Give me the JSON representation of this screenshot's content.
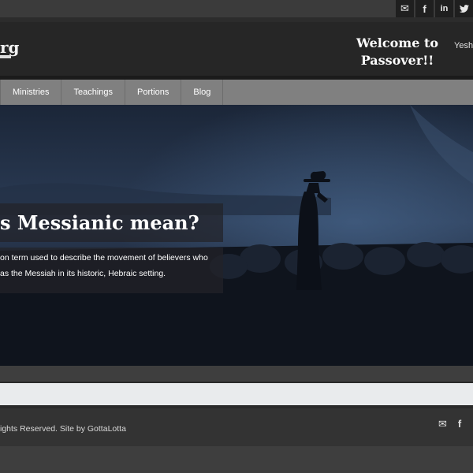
{
  "social_top": {
    "email_glyph": "✉",
    "facebook_glyph": "f",
    "linkedin_glyph": "in",
    "twitter_glyph": "🐦"
  },
  "header": {
    "logo_text": "rg",
    "welcome_line1": "Welcome to",
    "welcome_line2": "Passover!!",
    "right_text": "Yeshu"
  },
  "nav": {
    "items": [
      "Ministries",
      "Teachings",
      "Portions",
      "Blog"
    ]
  },
  "hero": {
    "title": "s Messianic mean?",
    "text_line1": "on term used to describe the movement of believers who",
    "text_line2": "as the Messiah in its historic, Hebraic setting."
  },
  "footer": {
    "text": "ights Reserved. Site by GottaLotta",
    "email_glyph": "✉",
    "facebook_glyph": "f"
  },
  "colors": {
    "background": "#3e3e3e",
    "header": "#262626",
    "nav": "#808080",
    "hero": "#131b27",
    "footer": "#333333"
  }
}
